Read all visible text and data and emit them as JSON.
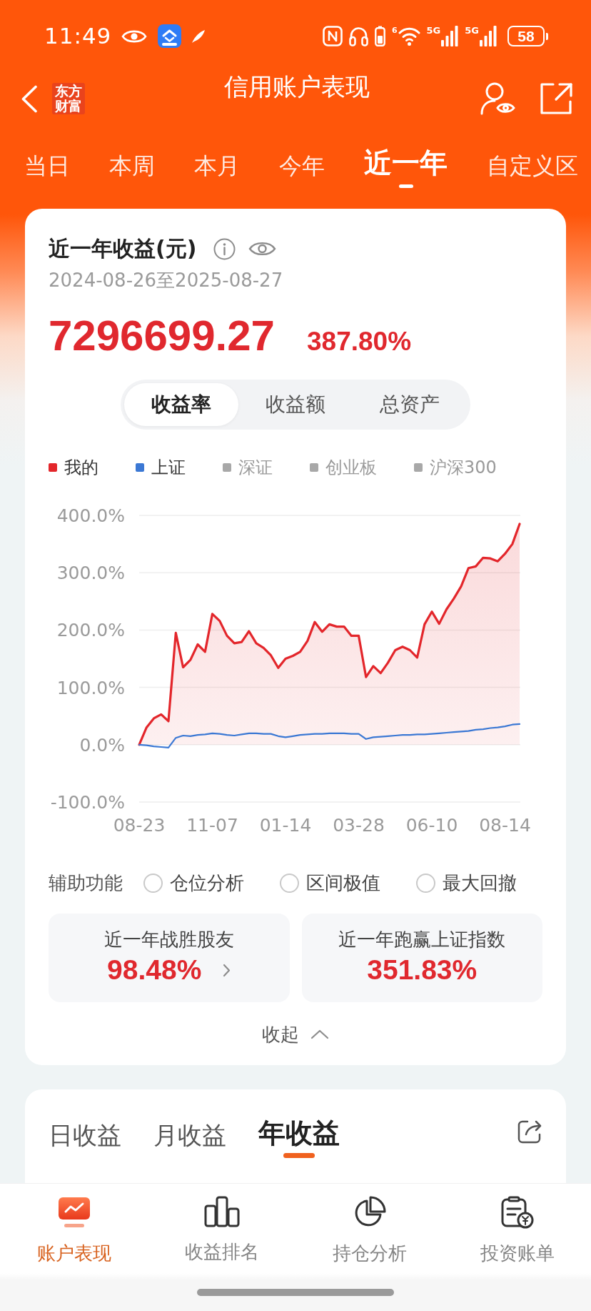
{
  "status_bar": {
    "time": "11:49",
    "wifi_label": "6",
    "network_labels": [
      "5G",
      "5G"
    ],
    "battery": "58"
  },
  "header": {
    "logo": "东方财富",
    "title": "信用账户表现"
  },
  "period_tabs": [
    {
      "label": "当日",
      "selected": false
    },
    {
      "label": "本周",
      "selected": false
    },
    {
      "label": "本月",
      "selected": false
    },
    {
      "label": "今年",
      "selected": false
    },
    {
      "label": "近一年",
      "selected": true
    },
    {
      "label": "自定义区",
      "selected": false
    }
  ],
  "summary_card": {
    "title": "近一年收益(元)",
    "date_range": "2024-08-26至2025-08-27",
    "amount": "7296699.27",
    "rate": "387.80%",
    "view_tabs": [
      {
        "label": "收益率",
        "selected": true
      },
      {
        "label": "收益额",
        "selected": false
      },
      {
        "label": "总资产",
        "selected": false
      }
    ],
    "chart_data": {
      "type": "line",
      "grid": true,
      "categories": [
        "08-23",
        null,
        null,
        null,
        null,
        null,
        null,
        null,
        null,
        null,
        "11-07",
        null,
        null,
        null,
        null,
        null,
        null,
        null,
        null,
        null,
        "01-14",
        null,
        null,
        null,
        null,
        null,
        null,
        null,
        null,
        null,
        "03-28",
        null,
        null,
        null,
        null,
        null,
        null,
        null,
        null,
        null,
        "06-10",
        null,
        null,
        null,
        null,
        null,
        null,
        null,
        null,
        null,
        "08-14",
        null,
        null
      ],
      "ylim": [
        -100,
        400
      ],
      "yticks": [
        {
          "value": 400,
          "label": "400.0%"
        },
        {
          "value": 300,
          "label": "300.0%"
        },
        {
          "value": 200,
          "label": "200.0%"
        },
        {
          "value": 100,
          "label": "100.0%"
        },
        {
          "value": 0,
          "label": "0.0%"
        },
        {
          "value": -100,
          "label": "-100.0%"
        }
      ],
      "series": [
        {
          "name": "我的",
          "type": "area",
          "color": "#e3262b",
          "values": [
            0,
            30,
            46,
            53,
            41,
            195,
            135,
            148,
            175,
            162,
            228,
            216,
            190,
            177,
            179,
            198,
            177,
            169,
            156,
            134,
            150,
            155,
            162,
            181,
            214,
            197,
            210,
            206,
            206,
            190,
            190,
            118,
            137,
            125,
            143,
            165,
            171,
            165,
            152,
            210,
            232,
            211,
            236,
            255,
            276,
            308,
            311,
            326,
            325,
            320,
            333,
            350,
            385
          ]
        },
        {
          "name": "上证",
          "type": "line",
          "color": "#3b78d4",
          "values": [
            0,
            -1,
            -3,
            -4,
            -5,
            12,
            16,
            15,
            17,
            18,
            20,
            19,
            17,
            16,
            18,
            20,
            20,
            19,
            19,
            15,
            13,
            15,
            17,
            18,
            19,
            19,
            20,
            20,
            20,
            19,
            19,
            10,
            13,
            14,
            15,
            16,
            17,
            17,
            18,
            18,
            19,
            20,
            21,
            22,
            23,
            24,
            26,
            27,
            29,
            30,
            32,
            35,
            36
          ]
        }
      ]
    },
    "more_benchmarks": [
      {
        "label": "深证",
        "color": "#a8a8a8",
        "on": false
      },
      {
        "label": "创业板",
        "color": "#a8a8a8",
        "on": false
      },
      {
        "label": "沪深300",
        "color": "#a8a8a8",
        "on": false
      }
    ],
    "assist": {
      "label": "辅助功能",
      "options": [
        {
          "label": "仓位分析",
          "checked": false
        },
        {
          "label": "区间极值",
          "checked": false
        },
        {
          "label": "最大回撤",
          "checked": false
        }
      ]
    },
    "stats": [
      {
        "label": "近一年战胜股友",
        "value": "98.48%",
        "chevron": true
      },
      {
        "label": "近一年跑赢上证指数",
        "value": "351.83%",
        "chevron": false
      }
    ],
    "collapse_label": "收起"
  },
  "earnings_card": {
    "tabs": [
      {
        "label": "日收益",
        "selected": false
      },
      {
        "label": "月收益",
        "selected": false
      },
      {
        "label": "年收益",
        "selected": true
      }
    ]
  },
  "bottom_nav": [
    {
      "kind": "performance",
      "label": "账户表现",
      "selected": true
    },
    {
      "kind": "ranking",
      "label": "收益排名",
      "selected": false
    },
    {
      "kind": "holdings",
      "label": "持仓分析",
      "selected": false
    },
    {
      "kind": "bill",
      "label": "投资账单",
      "selected": false
    }
  ]
}
